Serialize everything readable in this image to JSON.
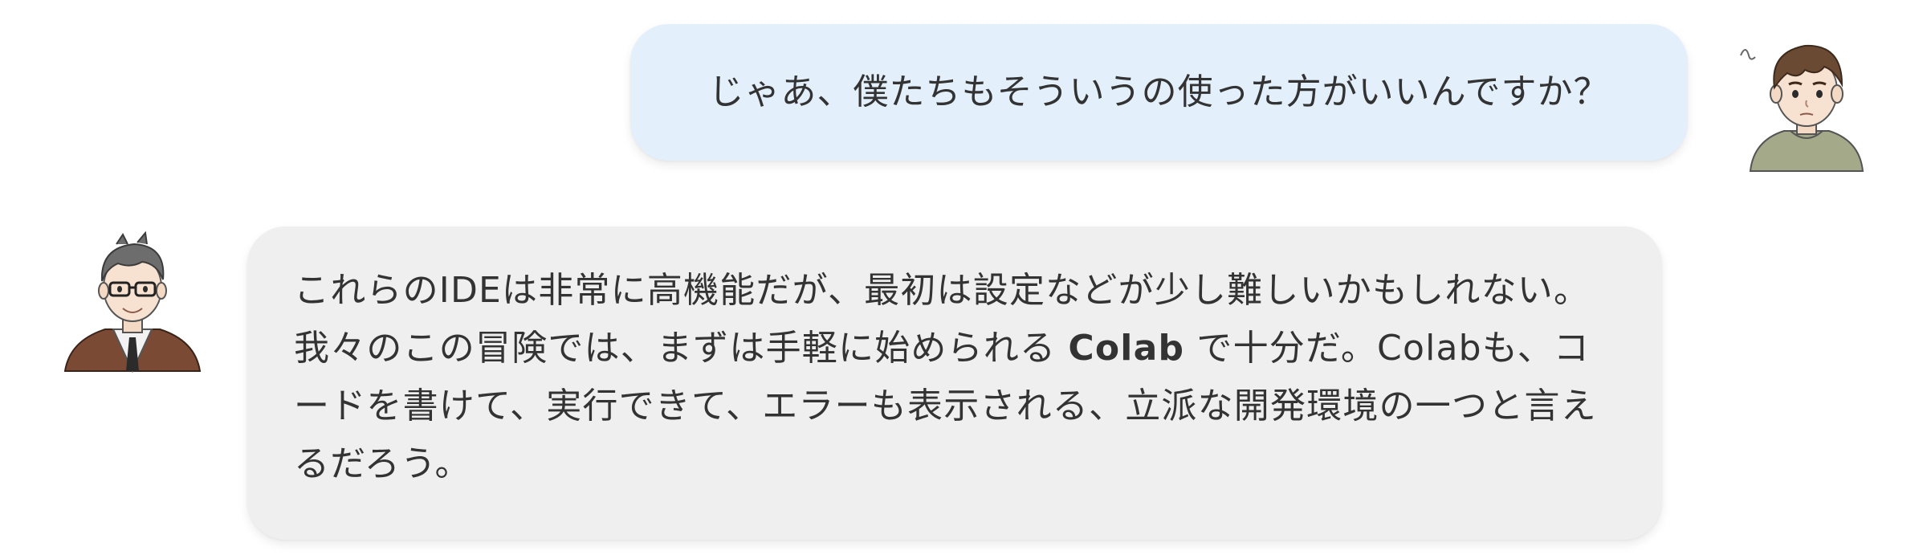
{
  "messages": [
    {
      "speaker": "student",
      "avatar_icon": "student-avatar-icon",
      "text": "じゃあ、僕たちもそういうの使った方がいいんですか？"
    },
    {
      "speaker": "teacher",
      "avatar_icon": "teacher-avatar-icon",
      "text_before": "これらのIDEは非常に高機能だが、最初は設定などが少し難しいかもしれない。我々のこの冒険では、まずは手軽に始められる ",
      "text_bold": "Colab",
      "text_after": " で十分だ。Colabも、コードを書けて、実行できて、エラーも表示される、立派な開発環境の一つと言えるだろう。"
    }
  ],
  "colors": {
    "user_bubble": "#e3f0fc",
    "teacher_bubble": "#efefef",
    "text": "#333333"
  }
}
